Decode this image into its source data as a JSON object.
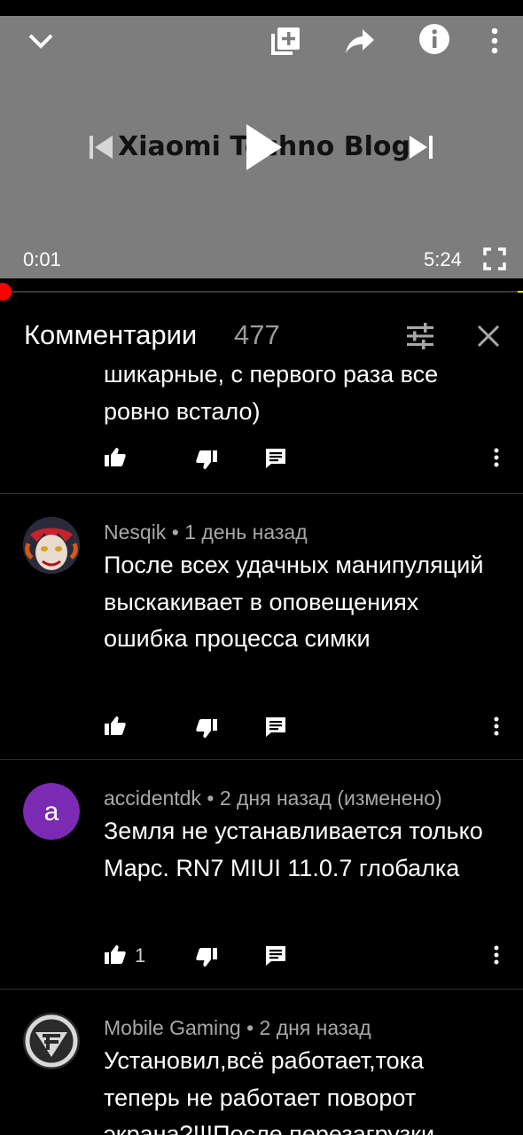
{
  "player": {
    "channel_brand": "Xiaomi Techno Blog",
    "current_time": "0:01",
    "duration": "5:24",
    "progress_fraction": 0.003,
    "icons": [
      "chevron-down-icon",
      "add-to-playlist-icon",
      "share-icon",
      "info-icon",
      "more-vert-icon",
      "previous-icon",
      "play-icon",
      "next-icon",
      "fullscreen-icon"
    ]
  },
  "comments_header": {
    "title": "Комментарии",
    "count": "477"
  },
  "comments": [
    {
      "id": "partial",
      "text_line1": "шикарные, с первого раза все",
      "text_line2": "ровно встало)",
      "like_count": ""
    },
    {
      "id": "nesqik",
      "author": "Nesqik",
      "time": "1 день назад",
      "text": "После всех удачных манипуляций выскакивает в оповещениях ошибка процесса симки",
      "like_count": ""
    },
    {
      "id": "accidentdk",
      "author": "accidentdk",
      "time": "2 дня назад (изменено)",
      "avatar_letter": "a",
      "avatar_color": "#7b2bb3",
      "text": "Земля не устанавливается только Марс. RN7 MIUI 11.0.7 глобалка",
      "like_count": "1"
    },
    {
      "id": "mobile-gaming",
      "author": "Mobile Gaming",
      "time": "2 дня назад",
      "text_line1": "Установил,всё работает,тока",
      "text_line2": "теперь не работает поворот",
      "text_line3": "экрана?!!!После перезагрузки",
      "like_count": ""
    }
  ],
  "separator": "•"
}
